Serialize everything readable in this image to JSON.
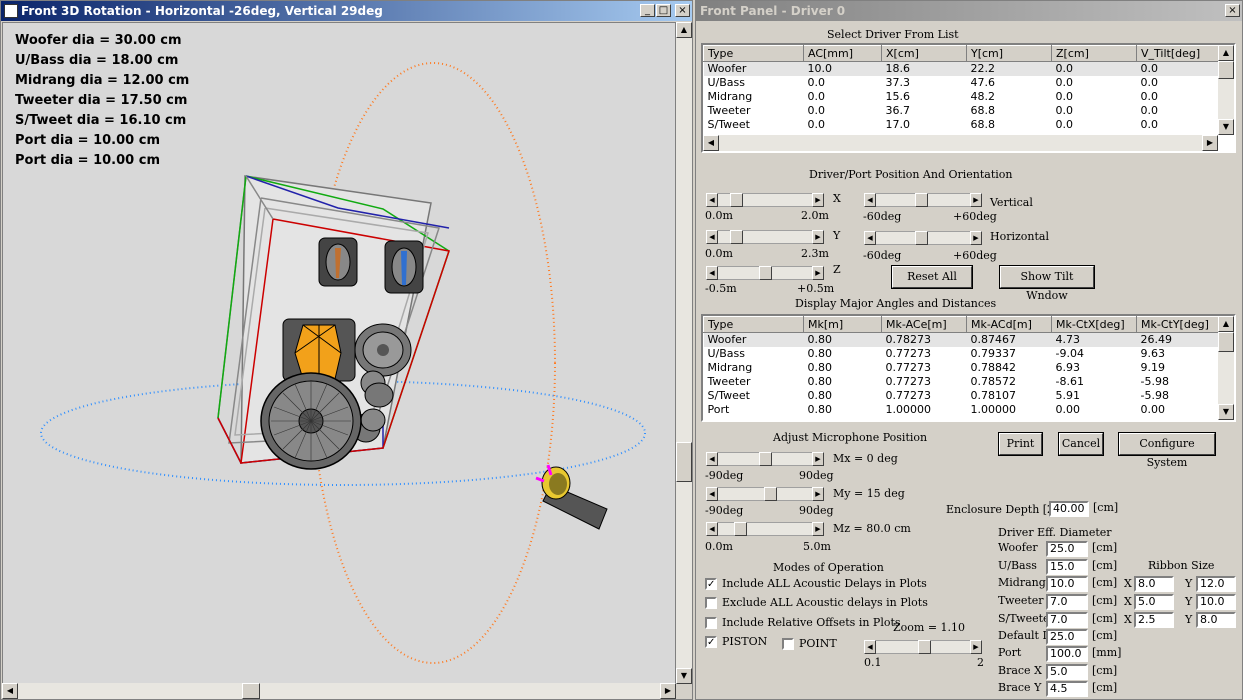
{
  "left_window": {
    "title": "Front 3D Rotation - Horizontal -26deg, Vertical 29deg",
    "diameters": [
      "Woofer dia = 30.00 cm",
      "U/Bass dia = 18.00 cm",
      "Midrang dia = 12.00 cm",
      "Tweeter dia = 17.50 cm",
      "S/Tweet dia = 16.10 cm",
      "Port dia = 10.00 cm",
      "Port dia = 10.00 cm"
    ],
    "controls": {
      "minimize": "_",
      "maximize": "□",
      "close": "×"
    }
  },
  "right_window": {
    "title": "Front Panel - Driver 0",
    "close": "×",
    "driver_list": {
      "heading": "Select Driver From List",
      "columns": [
        "Type",
        "AC[mm]",
        "X[cm]",
        "Y[cm]",
        "Z[cm]",
        "V_Tilt[deg]"
      ],
      "rows": [
        [
          "Woofer",
          "10.0",
          "18.6",
          "22.2",
          "0.0",
          "0.0"
        ],
        [
          "U/Bass",
          "0.0",
          "37.3",
          "47.6",
          "0.0",
          "0.0"
        ],
        [
          "Midrang",
          "0.0",
          "15.6",
          "48.2",
          "0.0",
          "0.0"
        ],
        [
          "Tweeter",
          "0.0",
          "36.7",
          "68.8",
          "0.0",
          "0.0"
        ],
        [
          "S/Tweet",
          "0.0",
          "17.0",
          "68.8",
          "0.0",
          "0.0"
        ]
      ]
    },
    "position": {
      "heading": "Driver/Port Position And Orientation",
      "x_label": "X",
      "x_min": "0.0m",
      "x_max": "2.0m",
      "y_label": "Y",
      "y_min": "0.0m",
      "y_max": "2.3m",
      "z_label": "Z",
      "z_min": "-0.5m",
      "z_max": "+0.5m",
      "vertical_label": "Vertical",
      "vertical_min": "-60deg",
      "vertical_max": "+60deg",
      "horizontal_label": "Horizontal",
      "horizontal_min": "-60deg",
      "horizontal_max": "+60deg",
      "reset_all": "Reset All",
      "show_tilt": "Show Tilt Wndow"
    },
    "angles": {
      "heading": "Display Major Angles and Distances",
      "columns": [
        "Type",
        "Mk[m]",
        "Mk-ACe[m]",
        "Mk-ACd[m]",
        "Mk-CtX[deg]",
        "Mk-CtY[deg]"
      ],
      "rows": [
        [
          "Woofer",
          "0.80",
          "0.78273",
          "0.87467",
          "4.73",
          "26.49"
        ],
        [
          "U/Bass",
          "0.80",
          "0.77273",
          "0.79337",
          "-9.04",
          "9.63"
        ],
        [
          "Midrang",
          "0.80",
          "0.77273",
          "0.78842",
          "6.93",
          "9.19"
        ],
        [
          "Tweeter",
          "0.80",
          "0.77273",
          "0.78572",
          "-8.61",
          "-5.98"
        ],
        [
          "S/Tweet",
          "0.80",
          "0.77273",
          "0.78107",
          "5.91",
          "-5.98"
        ],
        [
          "Port",
          "0.80",
          "1.00000",
          "1.00000",
          "0.00",
          "0.00"
        ]
      ]
    },
    "mic": {
      "heading": "Adjust Microphone Position",
      "mx": "Mx = 0 deg",
      "mx_min": "-90deg",
      "mx_max": "90deg",
      "my": "My = 15 deg",
      "my_min": "-90deg",
      "my_max": "90deg",
      "mz": "Mz = 80.0 cm",
      "mz_min": "0.0m",
      "mz_max": "5.0m"
    },
    "buttons": {
      "print": "Print",
      "cancel": "Cancel",
      "configure": "Configure System"
    },
    "enclosure": {
      "label": "Enclosure Depth [Z]",
      "value": "40.00",
      "unit": "[cm]"
    },
    "modes": {
      "heading": "Modes of Operation",
      "include_all": "Include ALL Acoustic Delays in Plots",
      "exclude_all": "Exclude ALL Acoustic delays in Plots",
      "include_rel": "Include Relative Offsets in Plots",
      "piston": "PISTON",
      "point": "POINT",
      "check": "✓"
    },
    "zoom": {
      "label": "Zoom = 1.10",
      "min": "0.1",
      "max": "2"
    },
    "eff_diam": {
      "heading": "Driver Eff. Diameter",
      "rows": [
        {
          "label": "Woofer",
          "value": "25.0",
          "unit": "[cm]"
        },
        {
          "label": "U/Bass",
          "value": "15.0",
          "unit": "[cm]"
        },
        {
          "label": "Midrange",
          "value": "10.0",
          "unit": "[cm]"
        },
        {
          "label": "Tweeter",
          "value": "7.0",
          "unit": "[cm]"
        },
        {
          "label": "S/Tweeter",
          "value": "7.0",
          "unit": "[cm]"
        },
        {
          "label": "Default D",
          "value": "25.0",
          "unit": "[cm]"
        },
        {
          "label": "Port",
          "value": "100.0",
          "unit": "[mm]"
        },
        {
          "label": "Brace X",
          "value": "5.0",
          "unit": "[cm]"
        },
        {
          "label": "Brace Y",
          "value": "4.5",
          "unit": "[cm]"
        }
      ]
    },
    "ribbon": {
      "heading": "Ribbon Size",
      "x": "X",
      "y": "Y",
      "rows": [
        {
          "x": "8.0",
          "y": "12.0"
        },
        {
          "x": "5.0",
          "y": "10.0"
        },
        {
          "x": "2.5",
          "y": "8.0"
        }
      ]
    }
  }
}
